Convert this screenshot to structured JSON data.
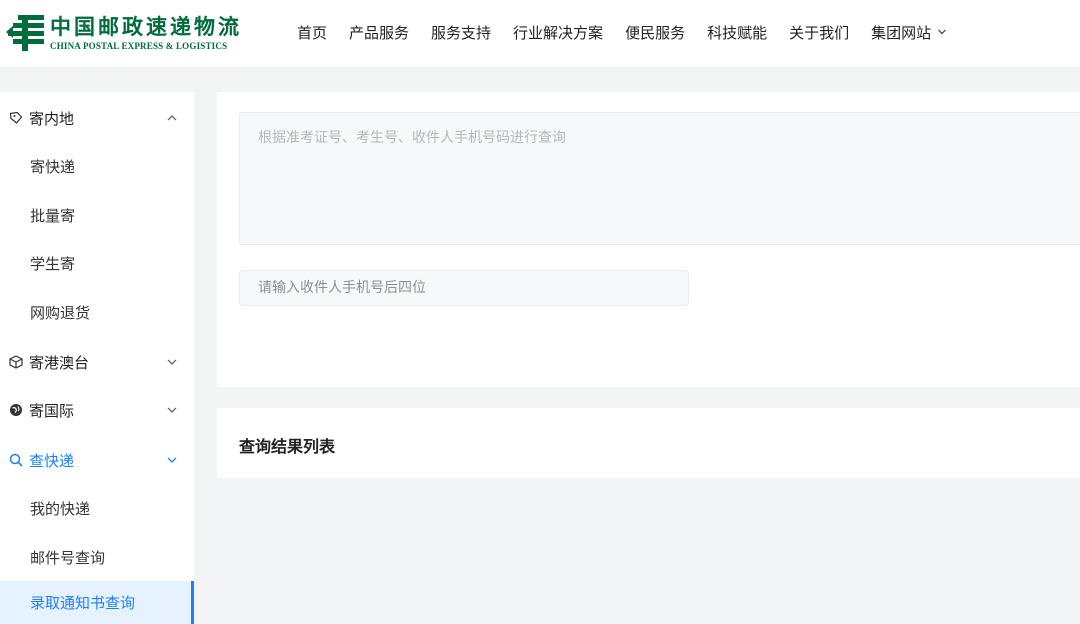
{
  "brand": {
    "name_cn": "中国邮政速递物流",
    "name_en": "CHINA POSTAL EXPRESS & LOGISTICS",
    "color": "#006b3c"
  },
  "nav": {
    "items": [
      {
        "label": "首页"
      },
      {
        "label": "产品服务"
      },
      {
        "label": "服务支持"
      },
      {
        "label": "行业解决方案"
      },
      {
        "label": "便民服务"
      },
      {
        "label": "科技赋能"
      },
      {
        "label": "关于我们"
      },
      {
        "label": "集团网站",
        "dropdown": true
      }
    ]
  },
  "sidebar": {
    "groups": [
      {
        "label": "寄内地",
        "icon": "tag-icon",
        "expanded": true
      },
      {
        "label": "寄港澳台",
        "icon": "box-icon",
        "expanded": false
      },
      {
        "label": "寄国际",
        "icon": "globe-icon",
        "expanded": false
      },
      {
        "label": "查快递",
        "icon": "search-icon",
        "expanded": true,
        "active": true
      }
    ],
    "sub_send": [
      {
        "label": "寄快递"
      },
      {
        "label": "批量寄"
      },
      {
        "label": "学生寄"
      },
      {
        "label": "网购退货"
      }
    ],
    "sub_query": [
      {
        "label": "我的快递"
      },
      {
        "label": "邮件号查询"
      },
      {
        "label": "录取通知书查询",
        "selected": true
      }
    ]
  },
  "query": {
    "textarea_placeholder": "根据准考证号、考生号、收件人手机号码进行查询",
    "phone_placeholder": "请输入收件人手机号后四位"
  },
  "result": {
    "title": "查询结果列表"
  },
  "colors": {
    "accent": "#1e80ff",
    "selected_bg": "#e6f2ff",
    "page_bg": "#f3f4f5"
  }
}
